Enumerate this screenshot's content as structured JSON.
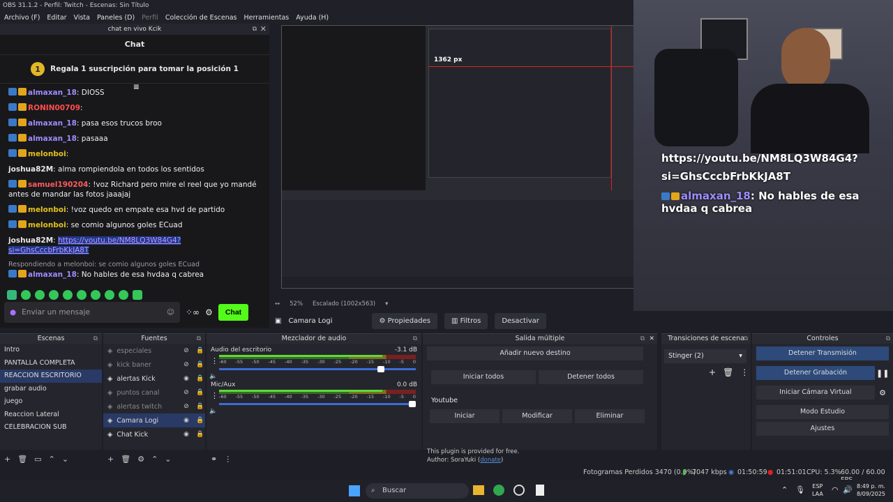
{
  "window": {
    "title": "OBS 31.1.2 - Perfil: Twitch - Escenas: Sin Título"
  },
  "menu": [
    "Archivo (F)",
    "Editar",
    "Vista",
    "Paneles (D)",
    "Perfil",
    "Colección de Escenas",
    "Herramientas",
    "Ayuda (H)"
  ],
  "chat": {
    "dock_title": "chat en vivo Kcik",
    "header": "Chat",
    "pinned": {
      "rank": "1",
      "text": "Regala 1 suscripción para tomar la posición 1"
    },
    "messages": [
      {
        "user": "almaxan_18",
        "color": "#9d8cff",
        "text": ": DIOSS"
      },
      {
        "user": "RONIN00709",
        "color": "#ff4d4d",
        "text": ":"
      },
      {
        "user": "almaxan_18",
        "color": "#9d8cff",
        "text": ": pasa esos trucos broo"
      },
      {
        "user": "almaxan_18",
        "color": "#9d8cff",
        "text": ": pasaaa"
      },
      {
        "user": "melonboi",
        "color": "#e3c11c",
        "text": ":"
      },
      {
        "user": "joshua82M",
        "color": "#e6e6e6",
        "text": ": alma rompiendola en todos los sentidos"
      },
      {
        "user": "samuel190204",
        "color": "#ff5b5b",
        "text": ": !voz Richard pero mire el reel que yo mandé antes de mandar las fotos jaaajaj"
      },
      {
        "user": "melonboi",
        "color": "#e3c11c",
        "text": ": !voz quedo en empate esa hvd de partido"
      },
      {
        "user": "melonboi",
        "color": "#e3c11c",
        "text": ": se comio algunos goles ECuad"
      },
      {
        "user": "joshua82M",
        "color": "#e6e6e6",
        "text": ": ",
        "link": "https://youtu.be/NM8LQ3W84G4?si=GhsCccbFrbKkJA8T"
      },
      {
        "reply": "Respondiendo a melonboi: se comio algunos goles ECuad",
        "user": "almaxan_18",
        "color": "#9d8cff",
        "text": ": No hables de esa hvdaa q cabrea"
      }
    ],
    "input_placeholder": "Enviar un mensaje",
    "send_label": "Chat"
  },
  "preview": {
    "zoom": "52%",
    "scaling": "Escalado (1002x563)",
    "overlay_px": "1362 px"
  },
  "cam_overlay": {
    "link_line1": "https://youtu.be/NM8LQ3W84G4?",
    "link_line2": "si=GhsCccbFrbKkJA8T",
    "user": "almaxan_18",
    "msg": ": No hables de esa hvdaa q cabrea"
  },
  "source_toolbar": {
    "source": "Camara Logi",
    "props": "Propiedades",
    "filters": "Filtros",
    "deactivate": "Desactivar"
  },
  "scenes": {
    "title": "Escenas",
    "items": [
      "Intro",
      "PANTALLA COMPLETA",
      "REACCION ESCRITORIO",
      "grabar audio",
      "juego",
      "Reaccion Lateral",
      "CELEBRACION SUB"
    ],
    "selected": 2
  },
  "sources": {
    "title": "Fuentes",
    "items": [
      {
        "name": "especiales",
        "visible": false
      },
      {
        "name": "kick baner",
        "visible": false
      },
      {
        "name": "alertas Kick",
        "visible": true
      },
      {
        "name": "puntos canal",
        "visible": false
      },
      {
        "name": "alertas twitch",
        "visible": false
      },
      {
        "name": "Camara Logi",
        "visible": true
      },
      {
        "name": "Chat Kick",
        "visible": true
      }
    ],
    "selected": 5
  },
  "mixer": {
    "title": "Mezclador de audio",
    "channels": [
      {
        "name": "Audio del escritorio",
        "db": "-3.1 dB",
        "level": 0.83,
        "volume": 0.84
      },
      {
        "name": "Mic/Aux",
        "db": "0.0 dB",
        "level": 0.83,
        "volume": 1.0
      }
    ],
    "ticks": [
      "-60",
      "-55",
      "-50",
      "-45",
      "-40",
      "-35",
      "-30",
      "-25",
      "-20",
      "-15",
      "-10",
      "-5",
      "0"
    ]
  },
  "multi": {
    "title": "Salida múltiple",
    "add": "Añadir nuevo destino",
    "start_all": "Iniciar todos",
    "stop_all": "Detener todos",
    "target": "Youtube",
    "start": "Iniciar",
    "modify": "Modificar",
    "delete": "Eliminar",
    "note": "This plugin is provided for free.",
    "author": "Author: SoraYuki (",
    "donate": "donate",
    "author_end": ")"
  },
  "transitions": {
    "title": "Transiciones de escena",
    "selected": "Stinger (2)"
  },
  "controls": {
    "title": "Controles",
    "stop_stream": "Detener Transmisión",
    "stop_rec": "Detener Grabación",
    "virtual_cam": "Iniciar Cámara Virtual",
    "studio": "Modo Estudio",
    "settings": "Ajustes"
  },
  "status": {
    "dropped": "Fotogramas Perdidos 3470 (0.9%)",
    "kbps": "7047 kbps",
    "stream_time": "01:50:59",
    "rec_time": "01:51:01",
    "cpu": "CPU: 5.3%",
    "fps": "60.00 / 60.00 FPS"
  },
  "taskbar": {
    "search": "Buscar",
    "lang1": "ESP",
    "lang2": "LAA",
    "time": "8:49 p. m.",
    "date": "8/09/2025"
  },
  "colors": {
    "accent": "#53fc18",
    "selection": "#2a3a66",
    "live_blue": "#2d4a7a",
    "record_red": "#e02020"
  }
}
